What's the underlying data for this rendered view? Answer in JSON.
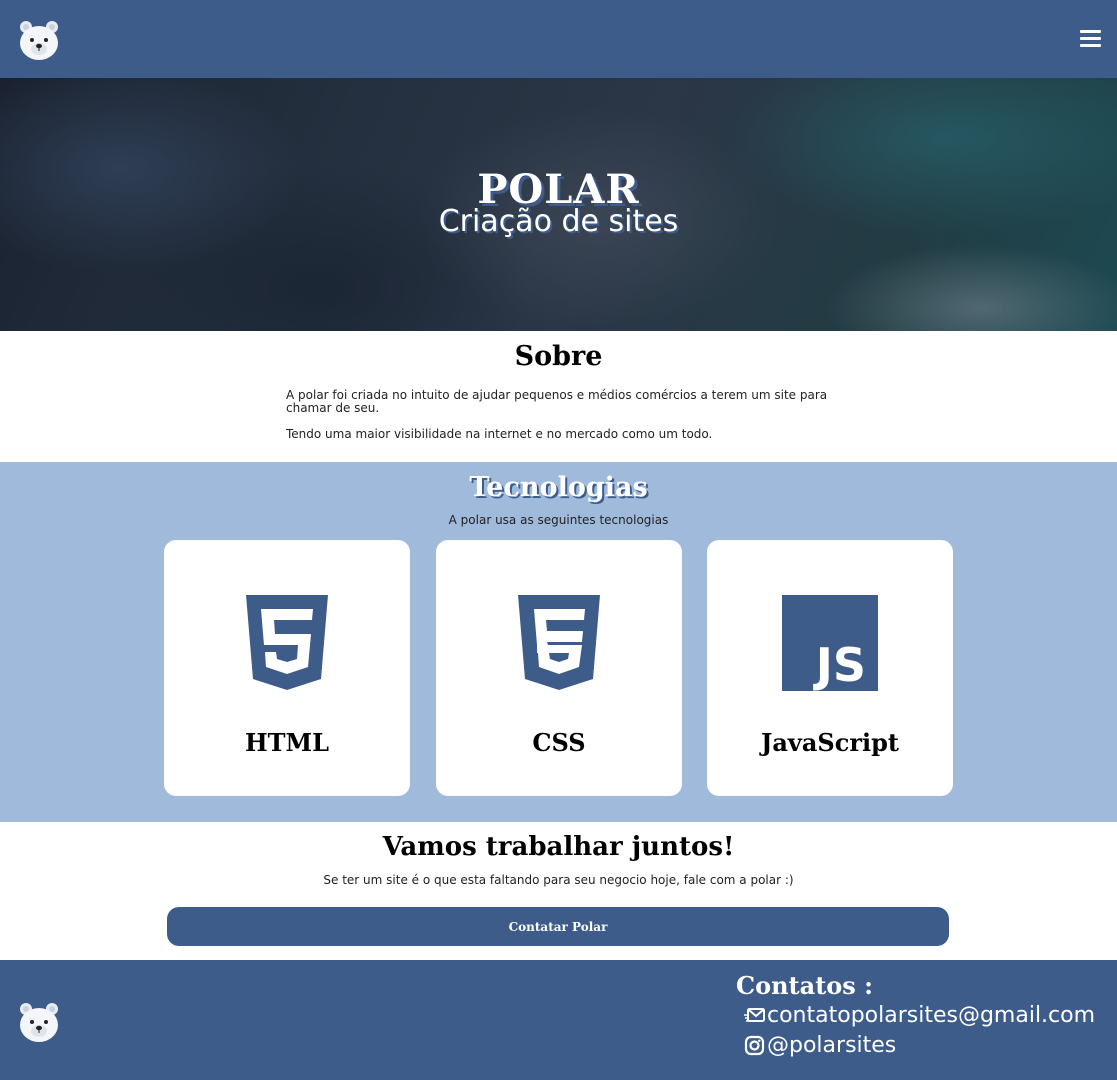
{
  "header": {
    "logo_icon": "polar-bear-icon",
    "menu_icon": "hamburger-menu-icon"
  },
  "hero": {
    "title": "POLAR",
    "subtitle": "Criação de sites"
  },
  "sobre": {
    "title": "Sobre",
    "paragraphs": [
      "A polar foi criada no intuito de ajudar pequenos e médios comércios a terem um site para chamar de seu.",
      "Tendo uma maior visibilidade na internet e no mercado como um todo."
    ]
  },
  "tecnologias": {
    "title": "Tecnologias",
    "subtitle": "A polar usa as seguintes tecnologias",
    "cards": [
      {
        "label": "HTML",
        "icon": "html5-icon"
      },
      {
        "label": "CSS",
        "icon": "css3-icon"
      },
      {
        "label": "JavaScript",
        "icon": "javascript-icon"
      }
    ]
  },
  "cta": {
    "title": "Vamos trabalhar juntos!",
    "text": "Se ter um site é o que esta faltando para seu negocio hoje, fale com a polar :)",
    "button_label": "Contatar Polar"
  },
  "footer": {
    "logo_icon": "polar-bear-icon",
    "contacts_title": "Contatos :",
    "email": "contatopolarsites@gmail.com",
    "email_icon": "email-icon",
    "instagram": "@polarsites",
    "instagram_icon": "instagram-icon"
  },
  "colors": {
    "primary": "#3e5c89",
    "tech_background": "#9fbadb",
    "white": "#ffffff"
  }
}
